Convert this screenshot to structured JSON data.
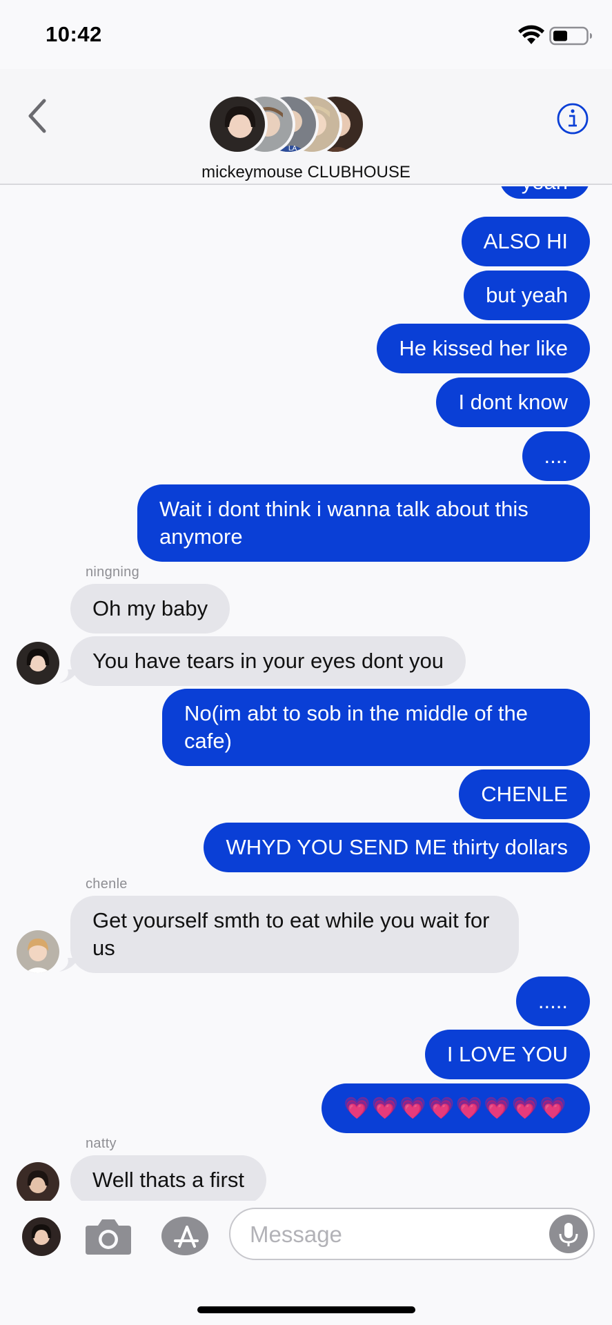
{
  "status_bar": {
    "time": "10:42"
  },
  "header": {
    "group_name": "mickeymouse CLUBHOUSE"
  },
  "messages": [
    {
      "dir": "out",
      "text": "yeah"
    },
    {
      "dir": "out",
      "text": "ALSO HI"
    },
    {
      "dir": "out",
      "text": "but yeah"
    },
    {
      "dir": "out",
      "text": "He kissed her like"
    },
    {
      "dir": "out",
      "text": "I dont know"
    },
    {
      "dir": "out",
      "text": "...."
    },
    {
      "dir": "out",
      "text": "Wait i dont think i wanna talk about this anymore"
    },
    {
      "dir": "in",
      "sender": "ningning",
      "text": "Oh my baby"
    },
    {
      "dir": "in",
      "text": "You have tears in your eyes dont you"
    },
    {
      "dir": "out",
      "text": "No(im abt to sob in the middle of the cafe)"
    },
    {
      "dir": "out",
      "text": "CHENLE"
    },
    {
      "dir": "out",
      "text": "WHYD YOU SEND ME thirty dollars"
    },
    {
      "dir": "in",
      "sender": "chenle",
      "text": "Get yourself smth to eat while you wait for us"
    },
    {
      "dir": "out",
      "text": "....."
    },
    {
      "dir": "out",
      "text": "I LOVE YOU"
    },
    {
      "dir": "out",
      "text": "💗💗💗💗💗💗💗💗"
    },
    {
      "dir": "in",
      "sender": "natty",
      "text": "Well thats a first"
    }
  ],
  "input": {
    "placeholder": "Message",
    "value": ""
  },
  "colors": {
    "outgoing": "#0a3fd6",
    "incoming": "#e5e5ea",
    "accent": "#0a3fd6"
  }
}
